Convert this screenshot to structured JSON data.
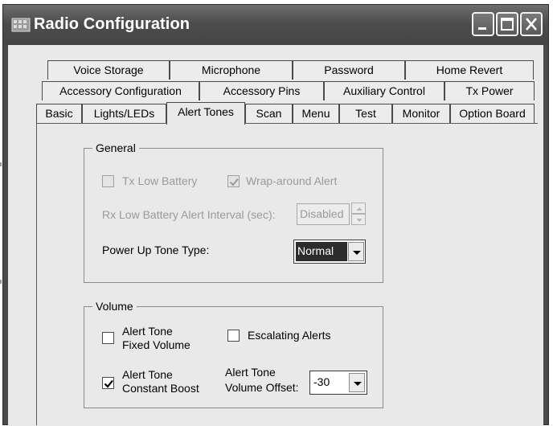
{
  "window": {
    "title": "Radio Configuration",
    "icons": {
      "app": "radio-app-icon",
      "minimize": "minimize-icon",
      "maximize": "maximize-icon",
      "close": "close-icon"
    }
  },
  "tabs": {
    "row1": [
      "Voice Storage",
      "Microphone",
      "Password",
      "Home Revert"
    ],
    "row2": [
      "Accessory Configuration",
      "Accessory Pins",
      "Auxiliary Control",
      "Tx Power"
    ],
    "row3": [
      "Basic",
      "Lights/LEDs",
      "Alert Tones",
      "Scan",
      "Menu",
      "Test",
      "Monitor",
      "Option Board"
    ],
    "active": "Alert Tones"
  },
  "general": {
    "title": "General",
    "tx_low_battery": {
      "label": "Tx Low Battery",
      "checked": false,
      "enabled": false
    },
    "wrap_around_alert": {
      "label": "Wrap-around Alert",
      "checked": true,
      "enabled": false
    },
    "rx_low_battery_interval": {
      "label": "Rx Low Battery Alert Interval (sec):",
      "value": "Disabled",
      "enabled": false
    },
    "power_up_tone_type": {
      "label": "Power Up Tone Type:",
      "value": "Normal"
    }
  },
  "volume": {
    "title": "Volume",
    "alert_tone_fixed_volume": {
      "label_line1": "Alert Tone",
      "label_line2": "Fixed Volume",
      "checked": false
    },
    "escalating_alerts": {
      "label": "Escalating Alerts",
      "checked": false
    },
    "alert_tone_constant_boost": {
      "label_line1": "Alert Tone",
      "label_line2": "Constant Boost",
      "checked": true
    },
    "alert_tone_volume_offset": {
      "label_line1": "Alert Tone",
      "label_line2": "Volume Offset:",
      "value": "-30"
    }
  }
}
